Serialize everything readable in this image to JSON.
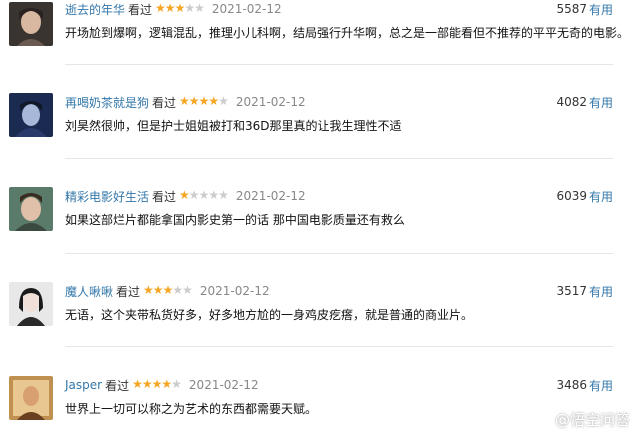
{
  "reviews": [
    {
      "username": "逝去的年华",
      "watched": "看过",
      "rating": 3,
      "date": "2021-02-12",
      "votes": "5587",
      "useful": "有用",
      "comment": "开场尬到爆啊，逻辑混乱，推理小儿科啊，结局强行升华啊，总之是一部能看但不推荐的平平无奇的电影。"
    },
    {
      "username": "再喝奶茶就是狗",
      "watched": "看过",
      "rating": 4,
      "date": "2021-02-12",
      "votes": "4082",
      "useful": "有用",
      "comment": "刘昊然很帅，但是护士姐姐被打和36D那里真的让我生理性不适"
    },
    {
      "username": "精彩电影好生活",
      "watched": "看过",
      "rating": 1,
      "date": "2021-02-12",
      "votes": "6039",
      "useful": "有用",
      "comment": "如果这部烂片都能拿国内影史第一的话 那中国电影质量还有救么"
    },
    {
      "username": "魔人啾啾",
      "watched": "看过",
      "rating": 3,
      "date": "2021-02-12",
      "votes": "3517",
      "useful": "有用",
      "comment": "无语，这个夹带私货好多，好多地方尬的一身鸡皮疙瘩，就是普通的商业片。"
    },
    {
      "username": "Jasper",
      "watched": "看过",
      "rating": 4,
      "date": "2021-02-12",
      "votes": "3486",
      "useful": "有用",
      "comment": "世界上一切可以称之为艺术的东西都需要天赋。"
    }
  ],
  "watermark": {
    "text": "@悟空问答",
    "icon": "wukong-logo-icon"
  },
  "colors": {
    "link": "#3377aa",
    "star": "#f5a623",
    "star_off": "#cccccc",
    "date": "#888888"
  }
}
